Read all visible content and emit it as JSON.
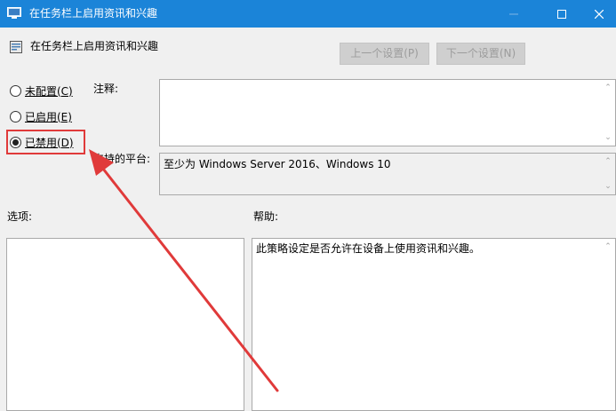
{
  "window": {
    "title": "在任务栏上启用资讯和兴趣",
    "minimize_icon": "minimize-icon",
    "maximize_icon": "maximize-icon",
    "close_icon": "close-icon"
  },
  "header": {
    "policy_name": "在任务栏上启用资讯和兴趣",
    "prev_button": "上一个设置(P)",
    "next_button": "下一个设置(N)"
  },
  "state": {
    "options": [
      {
        "label": "未配置(C)",
        "checked": false
      },
      {
        "label": "已启用(E)",
        "checked": false
      },
      {
        "label": "已禁用(D)",
        "checked": true
      }
    ]
  },
  "comment": {
    "label": "注释:",
    "value": ""
  },
  "supported": {
    "label": "支持的平台:",
    "value": "至少为 Windows Server 2016、Windows 10"
  },
  "options_pane": {
    "label": "选项:"
  },
  "help_pane": {
    "label": "帮助:",
    "text": "此策略设定是否允许在设备上使用资讯和兴趣。"
  },
  "annotation": {
    "color": "#e03a3a"
  }
}
